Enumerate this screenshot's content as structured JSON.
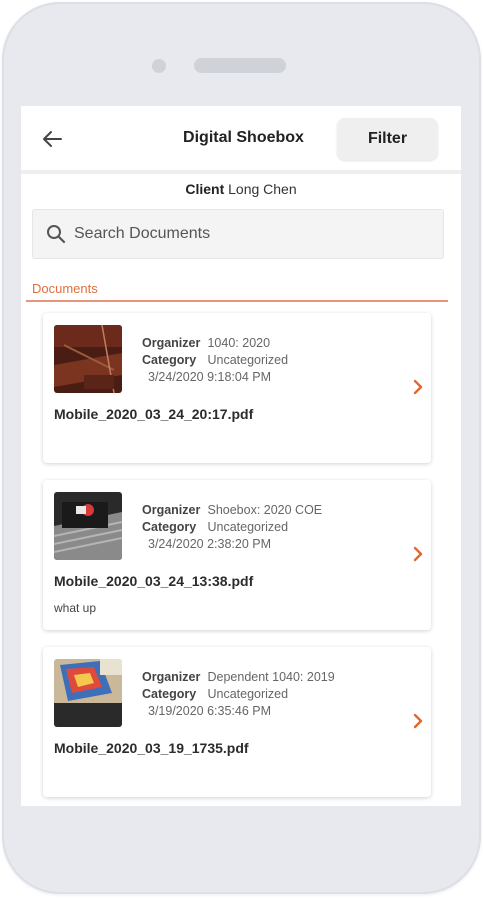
{
  "header": {
    "title": "Digital Shoebox",
    "filter_label": "Filter"
  },
  "client": {
    "label": "Client",
    "name": "Long Chen"
  },
  "search": {
    "placeholder": "Search Documents"
  },
  "section": {
    "label": "Documents"
  },
  "labels": {
    "organizer": "Organizer",
    "category": "Category"
  },
  "documents": [
    {
      "organizer": "1040: 2020",
      "category": "Uncategorized",
      "date": "3/24/2020 9:18:04 PM",
      "filename": "Mobile_2020_03_24_20:17.pdf",
      "note": ""
    },
    {
      "organizer": "Shoebox: 2020 COE",
      "category": "Uncategorized",
      "date": "3/24/2020 2:38:20 PM",
      "filename": "Mobile_2020_03_24_13:38.pdf",
      "note": "what up"
    },
    {
      "organizer": "Dependent 1040: 2019",
      "category": "Uncategorized",
      "date": "3/19/2020 6:35:46 PM",
      "filename": "Mobile_2020_03_19_1735.pdf",
      "note": ""
    }
  ],
  "colors": {
    "accent": "#e0703a",
    "chevron": "#e06a2e"
  }
}
